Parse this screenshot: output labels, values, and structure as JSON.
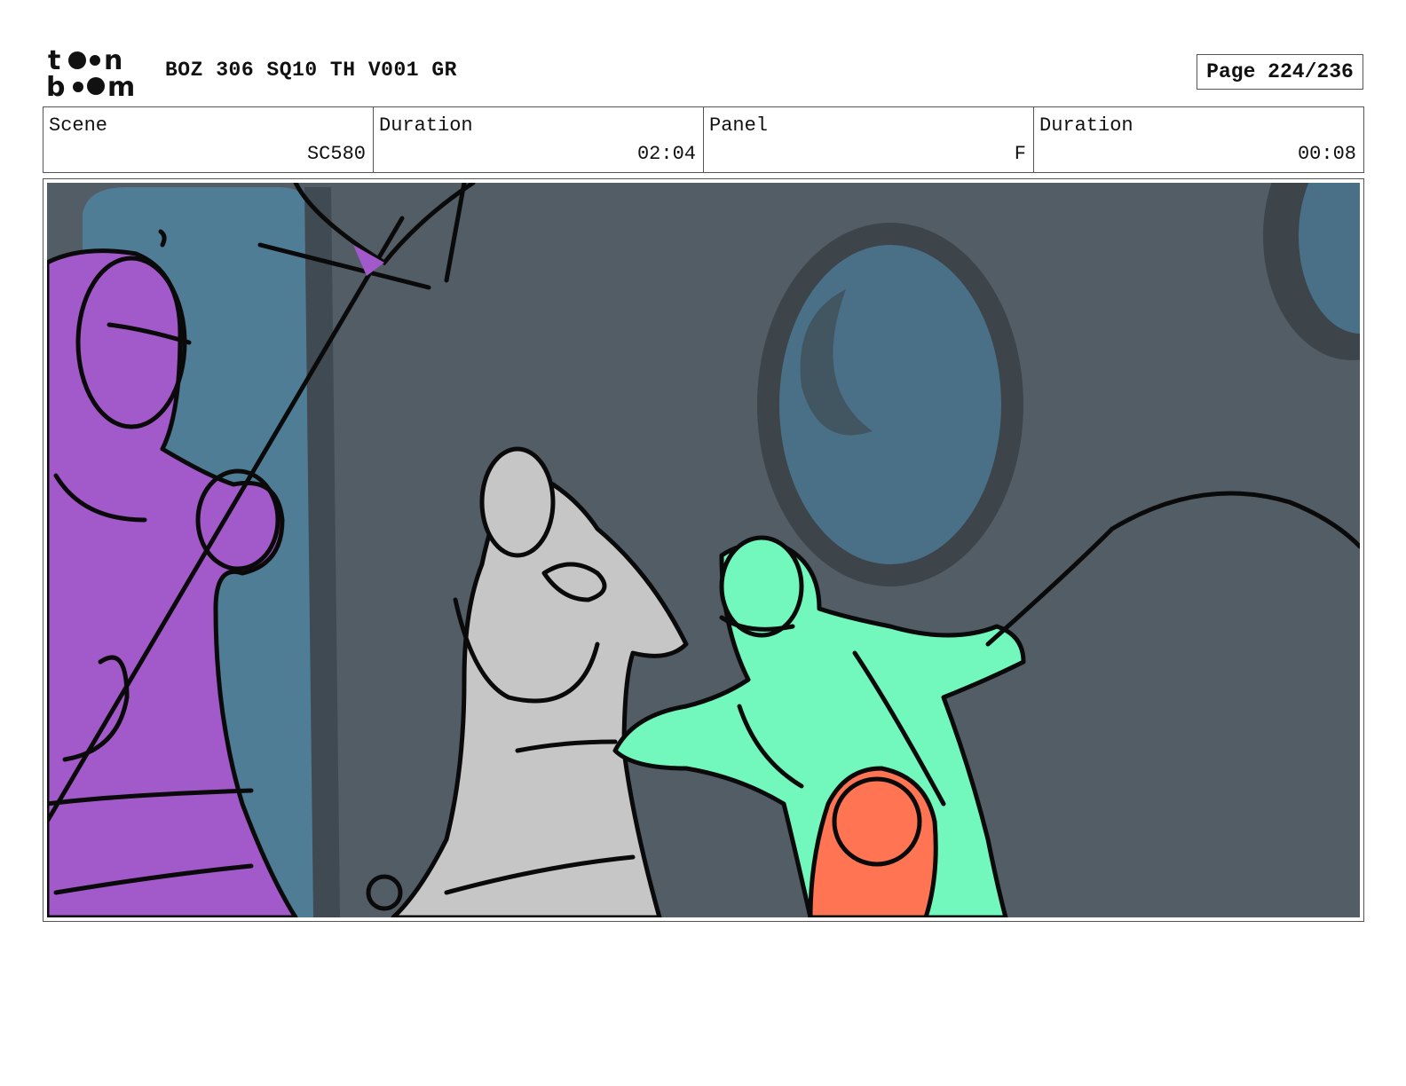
{
  "header": {
    "logo_text": "toon boom",
    "title": "BOZ 306 SQ10 TH V001 GR",
    "page_label": "Page 224/236"
  },
  "info": {
    "scene_label": "Scene",
    "scene_value": "SC580",
    "scene_duration_label": "Duration",
    "scene_duration_value": "02:04",
    "panel_label": "Panel",
    "panel_value": "F",
    "panel_duration_label": "Duration",
    "panel_duration_value": "00:08"
  },
  "colors": {
    "background_wall": "#525d66",
    "window_glass": "#4f7d96",
    "purple_character": "#a259c9",
    "grey_character": "#c6c6c6",
    "green_character": "#72f7bd",
    "orange_character": "#ff7554",
    "line_color": "#0a0a0a"
  }
}
